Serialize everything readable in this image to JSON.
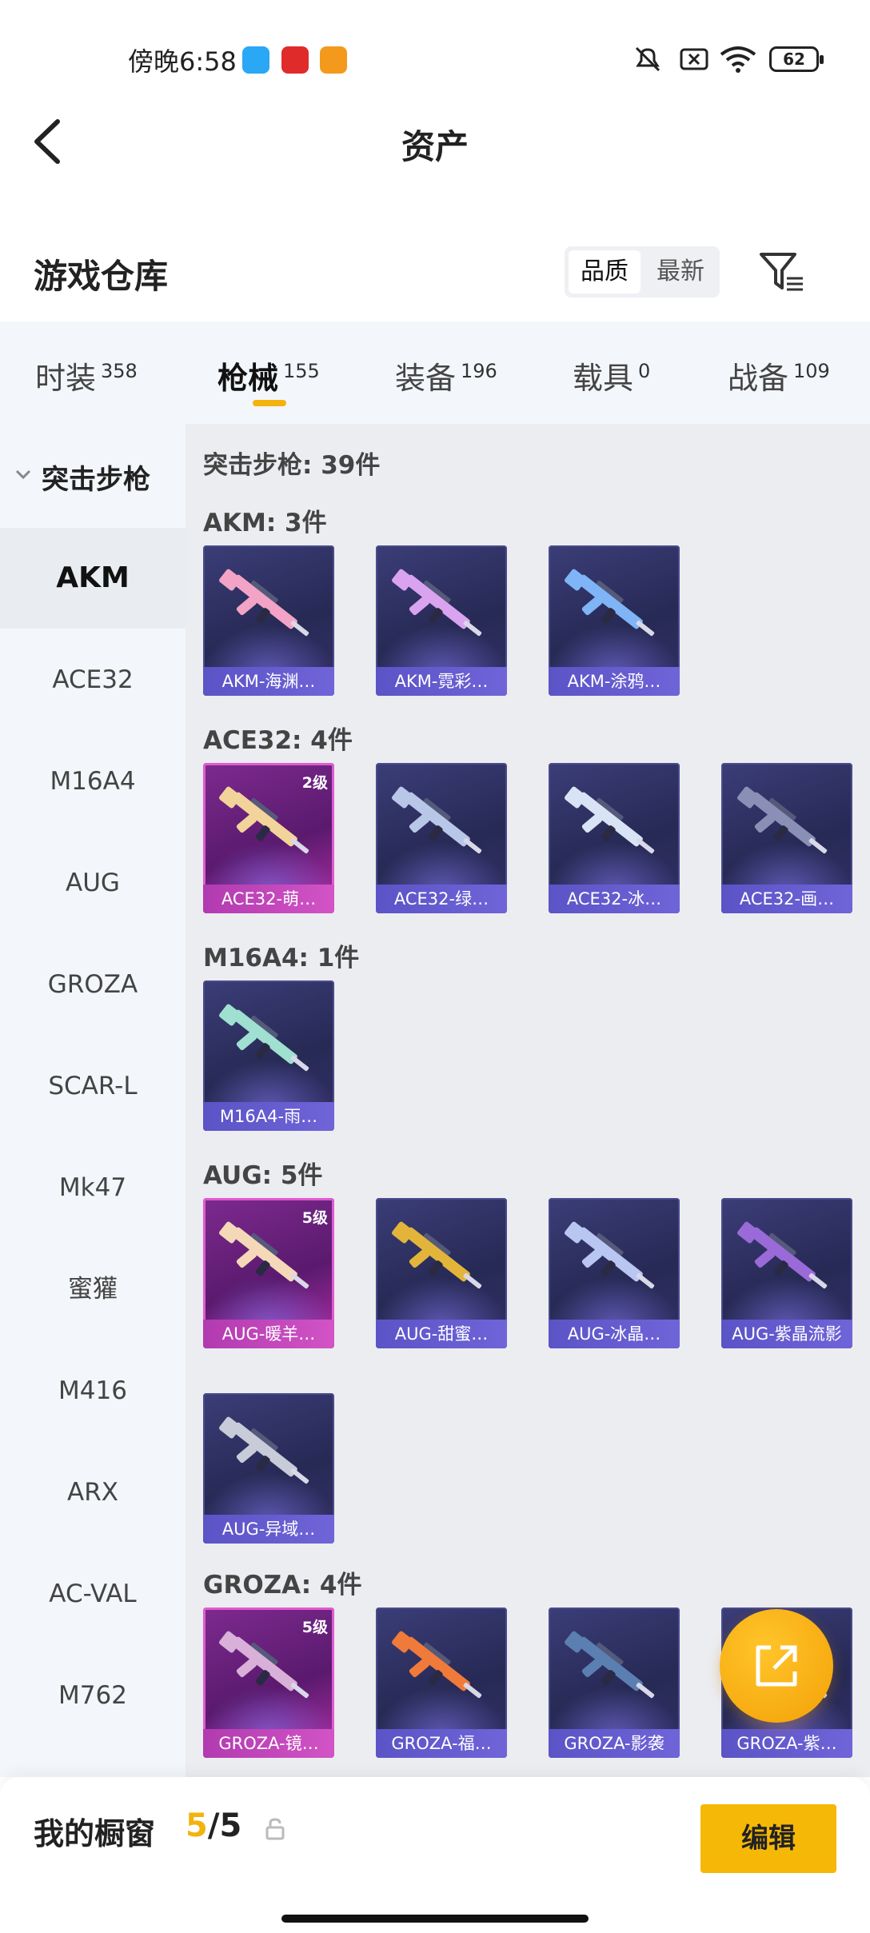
{
  "status_bar": {
    "time": "傍晚6:58",
    "battery": "62"
  },
  "header": {
    "title": "资产"
  },
  "warehouse": {
    "title": "游戏仓库",
    "sort_options": [
      "品质",
      "最新"
    ],
    "sort_selected": "品质"
  },
  "tabs": [
    {
      "label": "时装",
      "count": "358"
    },
    {
      "label": "枪械",
      "count": "155",
      "active": true
    },
    {
      "label": "装备",
      "count": "196"
    },
    {
      "label": "载具",
      "count": "0"
    },
    {
      "label": "战备",
      "count": "109"
    }
  ],
  "sidebar": {
    "category": "突击步枪",
    "items": [
      "AKM",
      "ACE32",
      "M16A4",
      "AUG",
      "GROZA",
      "SCAR-L",
      "Mk47",
      "蜜獾",
      "M416",
      "ARX",
      "AC-VAL",
      "M762"
    ],
    "active": "AKM"
  },
  "content": {
    "category_title": "突击步枪: 39件",
    "groups": [
      {
        "title": "AKM: 3件",
        "items": [
          {
            "label": "AKM-海渊…",
            "level": "",
            "gold": false,
            "color": "#f2a3c6"
          },
          {
            "label": "AKM-霓彩…",
            "level": "",
            "gold": false,
            "color": "#d9a3f0"
          },
          {
            "label": "AKM-涂鸦…",
            "level": "",
            "gold": false,
            "color": "#7fb4f6"
          }
        ]
      },
      {
        "title": "ACE32: 4件",
        "items": [
          {
            "label": "ACE32-萌…",
            "level": "2级",
            "gold": true,
            "color": "#f2d39a"
          },
          {
            "label": "ACE32-绿…",
            "level": "",
            "gold": false,
            "color": "#b8c7e8"
          },
          {
            "label": "ACE32-冰…",
            "level": "",
            "gold": false,
            "color": "#d8e4f5"
          },
          {
            "label": "ACE32-画…",
            "level": "",
            "gold": false,
            "color": "#8a8fb5"
          }
        ]
      },
      {
        "title": "M16A4: 1件",
        "items": [
          {
            "label": "M16A4-雨…",
            "level": "",
            "gold": false,
            "color": "#9fe0d0"
          }
        ]
      },
      {
        "title": "AUG: 5件",
        "items": [
          {
            "label": "AUG-暖羊…",
            "level": "5级",
            "gold": true,
            "color": "#f5d8b8"
          },
          {
            "label": "AUG-甜蜜…",
            "level": "",
            "gold": false,
            "color": "#e2b53a"
          },
          {
            "label": "AUG-冰晶…",
            "level": "",
            "gold": false,
            "color": "#b9c6f2"
          },
          {
            "label": "AUG-紫晶流影",
            "level": "",
            "gold": false,
            "color": "#9a6ad8"
          },
          {
            "label": "AUG-异域…",
            "level": "",
            "gold": false,
            "color": "#c8cbd8"
          }
        ]
      },
      {
        "title": "GROZA: 4件",
        "items": [
          {
            "label": "GROZA-镜…",
            "level": "5级",
            "gold": true,
            "color": "#d8b0d8"
          },
          {
            "label": "GROZA-福…",
            "level": "",
            "gold": false,
            "color": "#f07a3a"
          },
          {
            "label": "GROZA-影袭",
            "level": "",
            "gold": false,
            "color": "#5a7fb0"
          },
          {
            "label": "GROZA-紫…",
            "level": "",
            "gold": false,
            "color": "#9a6ad8"
          }
        ]
      }
    ]
  },
  "bottom_bar": {
    "label": "我的橱窗",
    "count_current": "5",
    "count_total": "/5",
    "edit_label": "编辑"
  },
  "colors": {
    "accent": "#f2b30f",
    "card_label": "#5b54c6",
    "gold_card": "#b23ab0"
  }
}
